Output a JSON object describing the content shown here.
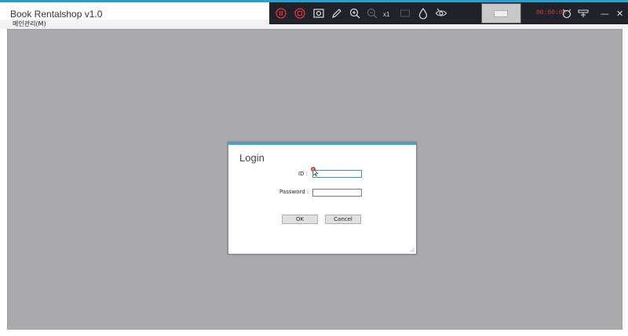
{
  "window": {
    "title": "Book Rentalshop v1.0"
  },
  "menu": {
    "items": [
      {
        "label": "메인관리(M)"
      }
    ]
  },
  "recorder": {
    "zoom_label": "x1",
    "timer": "00:00:00",
    "icons": [
      "pause-icon",
      "stop-icon",
      "screenshot-icon",
      "pen-icon",
      "zoom-in-icon",
      "zoom-out-icon",
      "fit-icon",
      "drop-icon",
      "eye-icon"
    ],
    "colors": {
      "toolbar_bg": "#1f2329",
      "record_red": "#e0353a"
    }
  },
  "login": {
    "title": "Login",
    "id_label": "ID :",
    "id_value": "",
    "password_label": "Password :",
    "password_value": "",
    "ok_label": "OK",
    "cancel_label": "Cancel"
  },
  "colors": {
    "accent": "#1ea3d6",
    "mdi_bg": "#abaaad"
  }
}
